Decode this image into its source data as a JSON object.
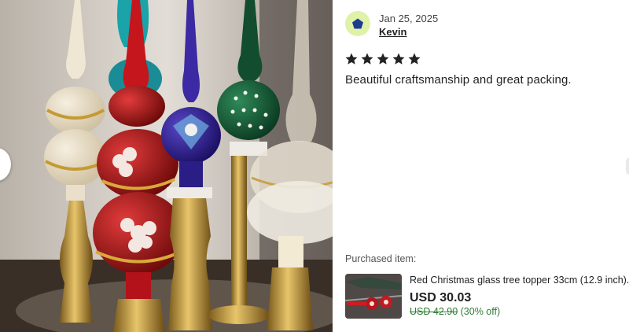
{
  "review": {
    "date": "Jan 25, 2025",
    "reviewer": "Kevin",
    "rating": 5,
    "text": "Beautiful craftsmanship and great packing."
  },
  "purchase": {
    "label": "Purchased item:",
    "title": "Red Christmas glass tree topper 33cm (12.9 inch).",
    "price": "USD 30.03",
    "original_price": "USD 42.90",
    "discount": "(30% off)"
  },
  "colors": {
    "avatar_bg": "#dff2a7",
    "avatar_icon": "#1d3b8f",
    "star": "#222222",
    "discount_green": "#2e7d32"
  },
  "icons": {
    "avatar": "pentagon-icon",
    "star": "star-icon",
    "prev": "chevron-left-icon"
  }
}
